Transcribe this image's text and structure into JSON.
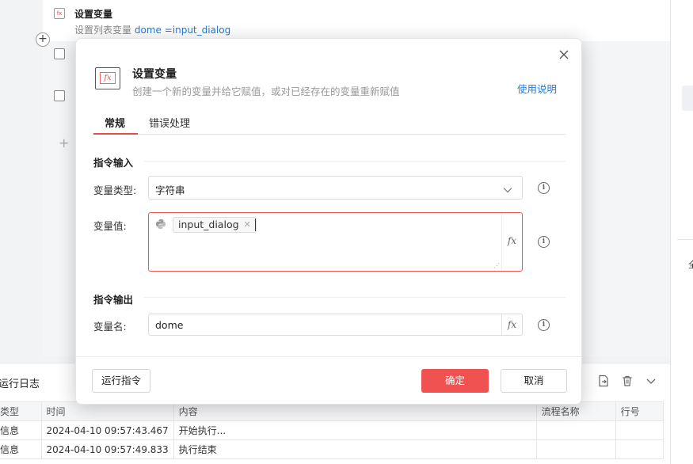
{
  "background": {
    "card": {
      "title": "设置变量",
      "desc_prefix": "设置列表变量",
      "var_name": "dome",
      "var_value": "=input_dialog"
    },
    "add_symbol": "+",
    "right_panel_char": "全"
  },
  "log": {
    "title": "运行日志",
    "columns": [
      "类型",
      "时间",
      "内容",
      "流程名称",
      "行号"
    ],
    "rows": [
      {
        "type": "信息",
        "time": "2024-04-10 09:57:43.467",
        "content": "开始执行...",
        "flow": "",
        "line": ""
      },
      {
        "type": "信息",
        "time": "2024-04-10 09:57:49.833",
        "content": "执行结束",
        "flow": "",
        "line": ""
      }
    ]
  },
  "dialog": {
    "title": "设置变量",
    "subtitle": "创建一个新的变量并给它赋值，或对已经存在的变量重新赋值",
    "help_link": "使用说明",
    "tabs": [
      "常规",
      "错误处理"
    ],
    "section_input": "指令输入",
    "section_output": "指令输出",
    "var_type_label": "变量类型:",
    "var_type_value": "字符串",
    "var_value_label": "变量值:",
    "var_value_chip": "input_dialog",
    "var_name_label": "变量名:",
    "var_name_value": "dome",
    "fx_label": "fx",
    "info_glyph": "i",
    "buttons": {
      "run": "运行指令",
      "ok": "确定",
      "cancel": "取消"
    },
    "accent_color": "#f05151",
    "link_color": "#1f7ad8"
  }
}
